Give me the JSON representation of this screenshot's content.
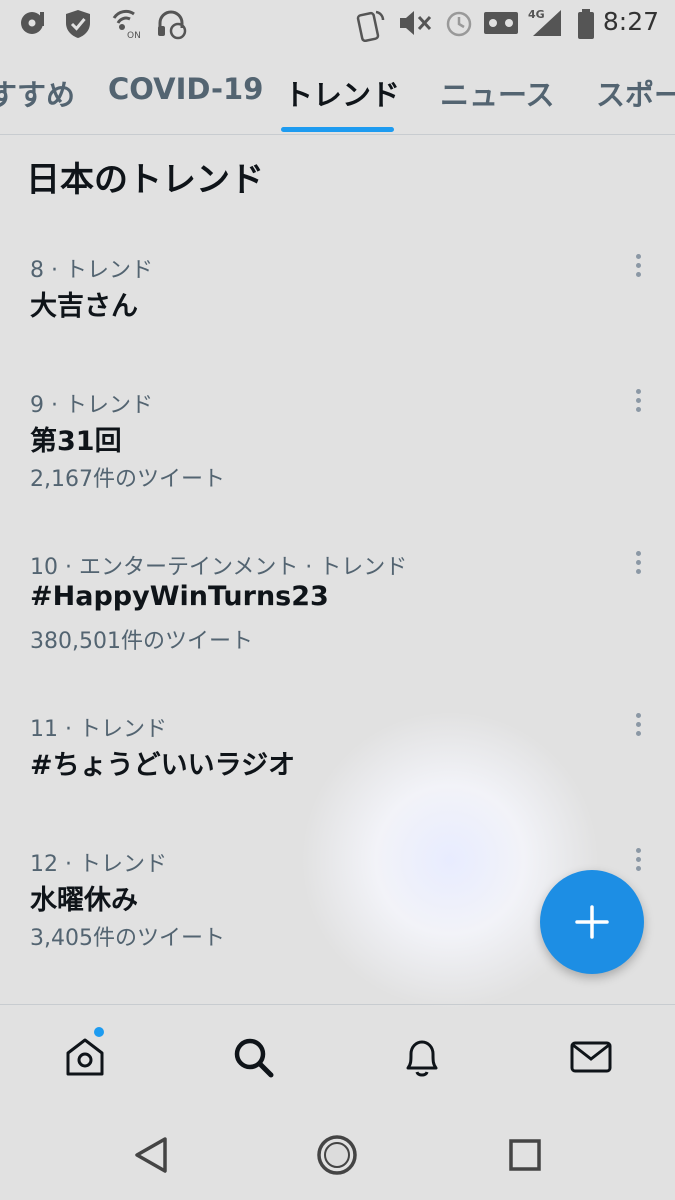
{
  "status_bar": {
    "time": "8:27",
    "network": "4G",
    "icons_left": [
      "media-icon",
      "shield-icon",
      "hotspot-icon",
      "headphones-icon"
    ],
    "icons_right": [
      "nfc-icon",
      "mute-icon",
      "alarm-icon",
      "voicemail-icon",
      "signal-icon",
      "battery-icon"
    ]
  },
  "tabs": [
    {
      "label": "すすめ"
    },
    {
      "label": "COVID-19"
    },
    {
      "label": "トレンド",
      "active": true
    },
    {
      "label": "ニュース"
    },
    {
      "label": "スポー"
    }
  ],
  "section_title": "日本のトレンド",
  "trends": [
    {
      "meta": "8 · トレンド",
      "name": "大吉さん",
      "count": ""
    },
    {
      "meta": "9 · トレンド",
      "name": "第31回",
      "count": "2,167件のツイート"
    },
    {
      "meta": "10 · エンターテインメント · トレンド",
      "name": "#HappyWinTurns23",
      "count": "380,501件のツイート"
    },
    {
      "meta": "11 · トレンド",
      "name": "#ちょうどいいラジオ",
      "count": ""
    },
    {
      "meta": "12 · トレンド",
      "name": "水曜休み",
      "count": "3,405件のツイート"
    }
  ],
  "fab_icon": "plus-icon",
  "bottom_nav": [
    "home-icon",
    "search-icon",
    "bell-icon",
    "mail-icon"
  ],
  "system_nav": [
    "back-icon",
    "home-circle-icon",
    "recents-icon"
  ],
  "colors": {
    "accent": "#1d9bf0",
    "background": "#e1e1e1",
    "muted_text": "#536471"
  }
}
